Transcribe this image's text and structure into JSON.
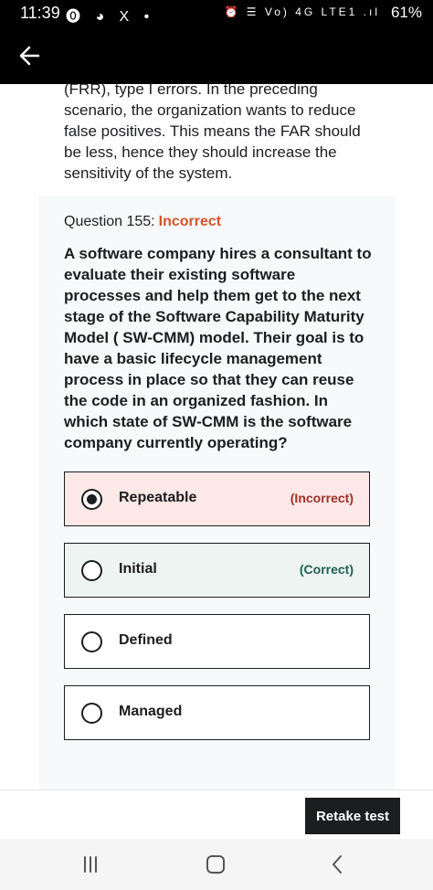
{
  "status_bar": {
    "time": "11:39",
    "left_icons": "⓿ ◕ X •",
    "right_icons": "⏰ ☰ Vo) 4G LTE1 .ıl",
    "battery": "61%"
  },
  "app_bar": {
    "back_icon": "arrow-left-icon"
  },
  "explanation": {
    "text_partial_top": "(FRR), type I errors. In the preceding",
    "text": "scenario, the organization wants to reduce false positives. This means the FAR should be less, hence they should increase the sensitivity of the system."
  },
  "question": {
    "label": "Question 155:",
    "status": "Incorrect",
    "text": "A software company hires a consultant to evaluate their existing software processes and help them get to the next stage of the Software Capability Maturity Model ( SW-CMM) model. Their goal is to have a basic lifecycle management process in place so that they can reuse the code in an organized fashion. In which state of SW-CMM is the software company currently operating?"
  },
  "options": [
    {
      "label": "Repeatable",
      "tag": "(Incorrect)",
      "selected": true
    },
    {
      "label": "Initial",
      "tag": "(Correct)",
      "selected": false
    },
    {
      "label": "Defined",
      "tag": "",
      "selected": false
    },
    {
      "label": "Managed",
      "tag": "",
      "selected": false
    }
  ],
  "footer": {
    "retake_label": "Retake test"
  },
  "colors": {
    "incorrect_accent": "#d6542c",
    "incorrect_bg": "#fce8e6",
    "correct_bg": "#eef4f1",
    "correct_text": "#1e6055",
    "dark": "#1c1d1f"
  },
  "nav": {
    "recents_icon": "recents-icon",
    "home_icon": "home-icon",
    "back_icon": "back-chevron-icon"
  }
}
